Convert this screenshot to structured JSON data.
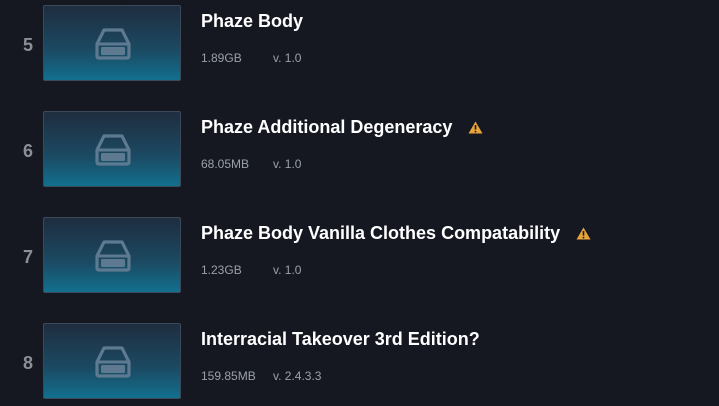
{
  "mods": [
    {
      "index": "5",
      "title": "Phaze Body",
      "size": "1.89GB",
      "version": "v. 1.0",
      "warning": false
    },
    {
      "index": "6",
      "title": "Phaze Additional Degeneracy",
      "size": "68.05MB",
      "version": "v. 1.0",
      "warning": true
    },
    {
      "index": "7",
      "title": "Phaze Body Vanilla Clothes Compatability",
      "size": "1.23GB",
      "version": "v. 1.0",
      "warning": true
    },
    {
      "index": "8",
      "title": "Interracial Takeover 3rd Edition?",
      "size": "159.85MB",
      "version": "v. 2.4.3.3",
      "warning": false
    }
  ],
  "icons": {
    "thumbnail": "drive-icon",
    "warning": "warning-icon"
  },
  "colors": {
    "background": "#151821",
    "warning": "#e8a43a"
  }
}
